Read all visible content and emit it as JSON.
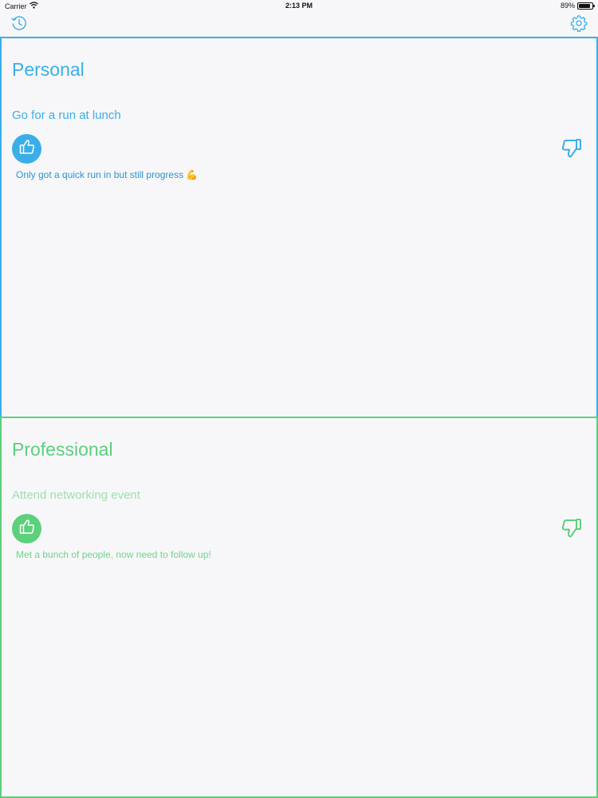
{
  "status_bar": {
    "carrier": "Carrier",
    "time": "2:13 PM",
    "battery": "89%",
    "battery_level": 0.89
  },
  "toolbar": {
    "history_icon": "history-clock-icon",
    "settings_icon": "gear-icon"
  },
  "colors": {
    "personal_accent": "#3aaee8",
    "professional_accent": "#5cd07c"
  },
  "sections": [
    {
      "title": "Personal",
      "goal": "Go for a run at lunch",
      "note": "Only got a quick run in but still progress 💪"
    },
    {
      "title": "Professional",
      "goal": "Attend networking event",
      "note": "Met a bunch of people, now need to follow up!"
    }
  ]
}
